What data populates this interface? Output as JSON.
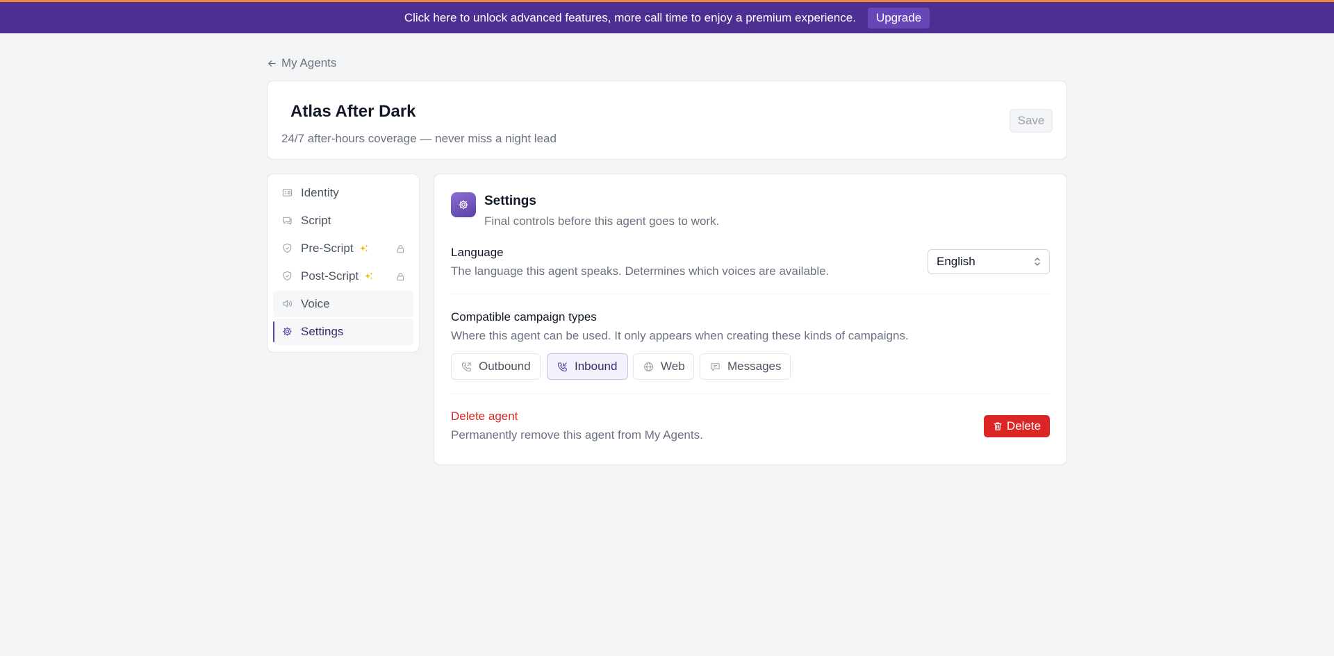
{
  "banner": {
    "text": "Click here to unlock advanced features, more call time to enjoy a premium experience.",
    "upgrade_label": "Upgrade",
    "background": "#4c2f91"
  },
  "back_link": {
    "label": "My Agents",
    "icon": "arrow-left-icon"
  },
  "agent": {
    "name": "Atlas After Dark",
    "description": "24/7 after-hours coverage — never miss a night lead",
    "save_label": "Save"
  },
  "sidebar": {
    "items": [
      {
        "label": "Identity",
        "icon": "id-card-icon",
        "state": "default"
      },
      {
        "label": "Script",
        "icon": "chat-icon",
        "state": "default"
      },
      {
        "label": "Pre-Script",
        "icon": "shield-icon",
        "premium": true,
        "locked": true,
        "state": "default"
      },
      {
        "label": "Post-Script",
        "icon": "shield-icon",
        "premium": true,
        "locked": true,
        "state": "default"
      },
      {
        "label": "Voice",
        "icon": "speaker-icon",
        "state": "hover"
      },
      {
        "label": "Settings",
        "icon": "gear-icon",
        "state": "active"
      }
    ],
    "accent": "#5b3fa8",
    "premium_color": "#f5b400"
  },
  "settings": {
    "title": "Settings",
    "subtitle": "Final controls before this agent goes to work.",
    "language": {
      "label": "Language",
      "help": "The language this agent speaks. Determines which voices are available.",
      "selected": "English"
    },
    "campaign_types": {
      "label": "Compatible campaign types",
      "help": "Where this agent can be used. It only appears when creating these kinds of campaigns.",
      "options": [
        {
          "label": "Outbound",
          "icon": "phone-outgoing-icon",
          "selected": false
        },
        {
          "label": "Inbound",
          "icon": "phone-incoming-icon",
          "selected": true
        },
        {
          "label": "Web",
          "icon": "globe-icon",
          "selected": false
        },
        {
          "label": "Messages",
          "icon": "message-icon",
          "selected": false
        }
      ]
    },
    "delete": {
      "title": "Delete agent",
      "help": "Permanently remove this agent from My Agents.",
      "button_label": "Delete",
      "color": "#dc2626"
    }
  }
}
